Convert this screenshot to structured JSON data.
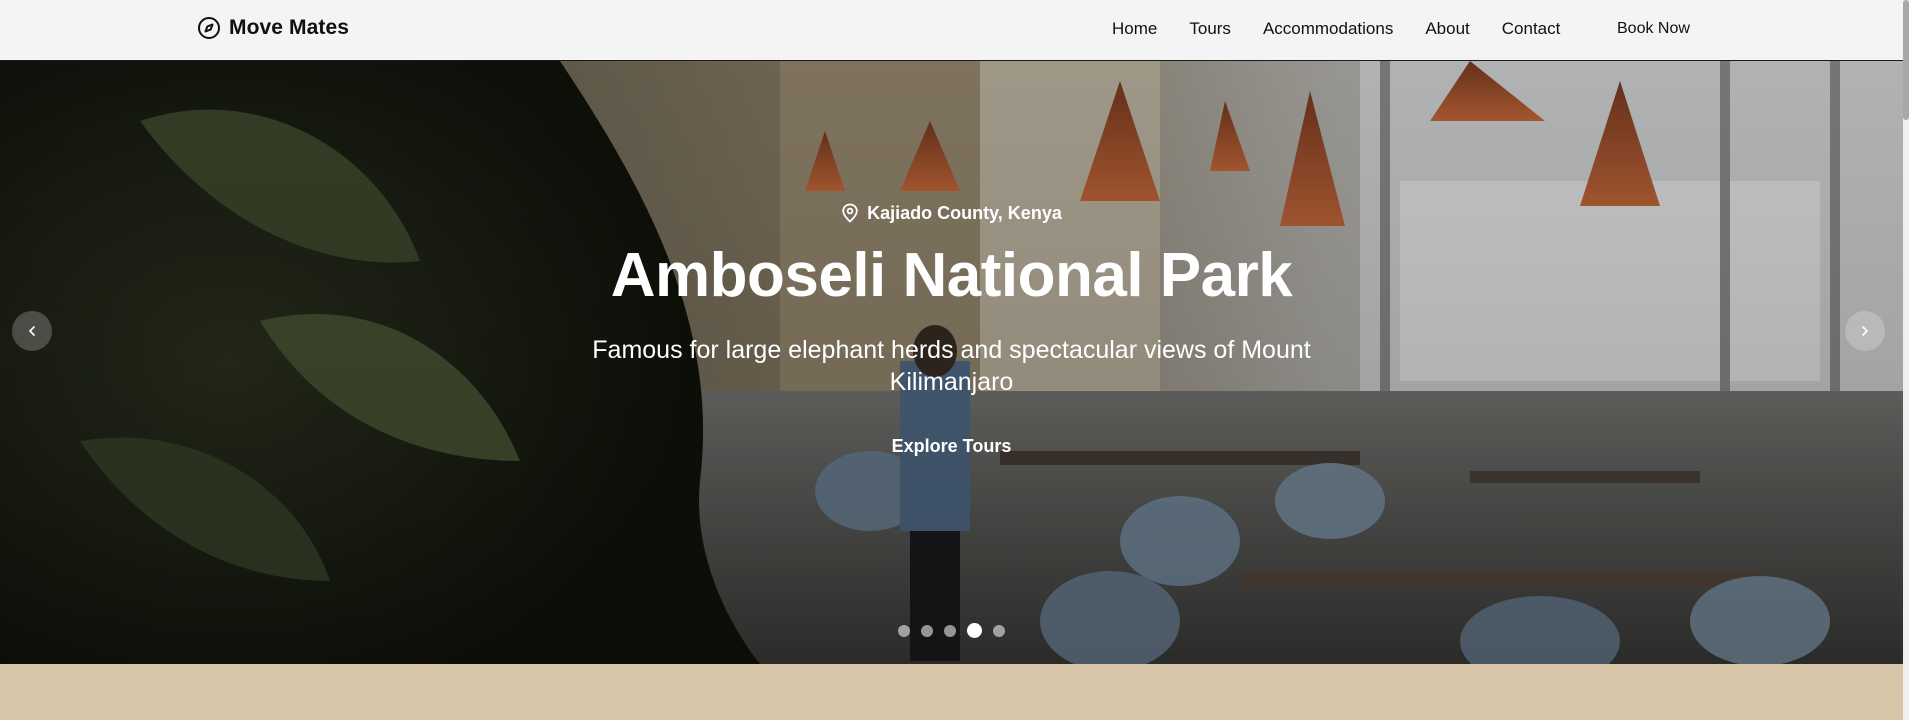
{
  "header": {
    "brand": "Move Mates",
    "nav": [
      "Home",
      "Tours",
      "Accommodations",
      "About",
      "Contact"
    ],
    "cta": "Book Now"
  },
  "hero": {
    "location": "Kajiado County, Kenya",
    "title": "Amboseli National Park",
    "description": "Famous for large elephant herds and spectacular views of Mount Kilimanjaro",
    "button": "Explore Tours",
    "slides_total": 5,
    "active_slide": 4
  },
  "colors": {
    "header_bg": "#f4f4f4",
    "page_bg": "#d6c5a6",
    "text_dark": "#111111",
    "text_light": "#ffffff"
  },
  "icons": {
    "brand": "compass-icon",
    "location": "map-pin-icon",
    "prev": "chevron-left-icon",
    "next": "chevron-right-icon"
  }
}
